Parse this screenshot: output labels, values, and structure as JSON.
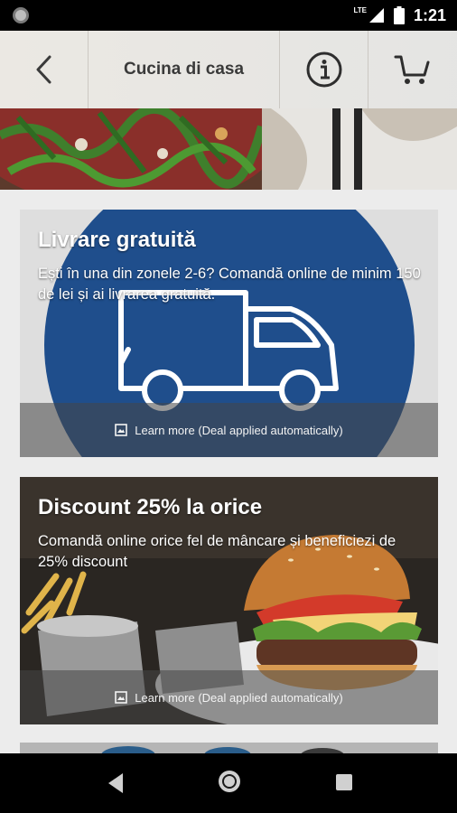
{
  "status_bar": {
    "network": "LTE",
    "time": "1:21"
  },
  "header": {
    "title": "Cucina di casa"
  },
  "deals": [
    {
      "title": "Livrare gratuită",
      "description": "Ești în una din zonele 2-6? Comandă online de minim 150 de lei și ai livrarea gratuită.",
      "link": "Learn more (Deal applied automatically)",
      "icon": "truck-icon"
    },
    {
      "title": "Discount 25% la orice",
      "description": "Comandă online orice fel de mâncare și beneficiezi de 25% discount",
      "link": "Learn more (Deal applied automatically)",
      "icon": "burger-image"
    }
  ],
  "colors": {
    "accent_blue": "#1f4e8c",
    "header_text": "#3a3a3a"
  },
  "icons": [
    "back-arrow-icon",
    "info-icon",
    "cart-icon",
    "image-icon",
    "nav-back-icon",
    "nav-home-icon",
    "nav-recents-icon"
  ]
}
